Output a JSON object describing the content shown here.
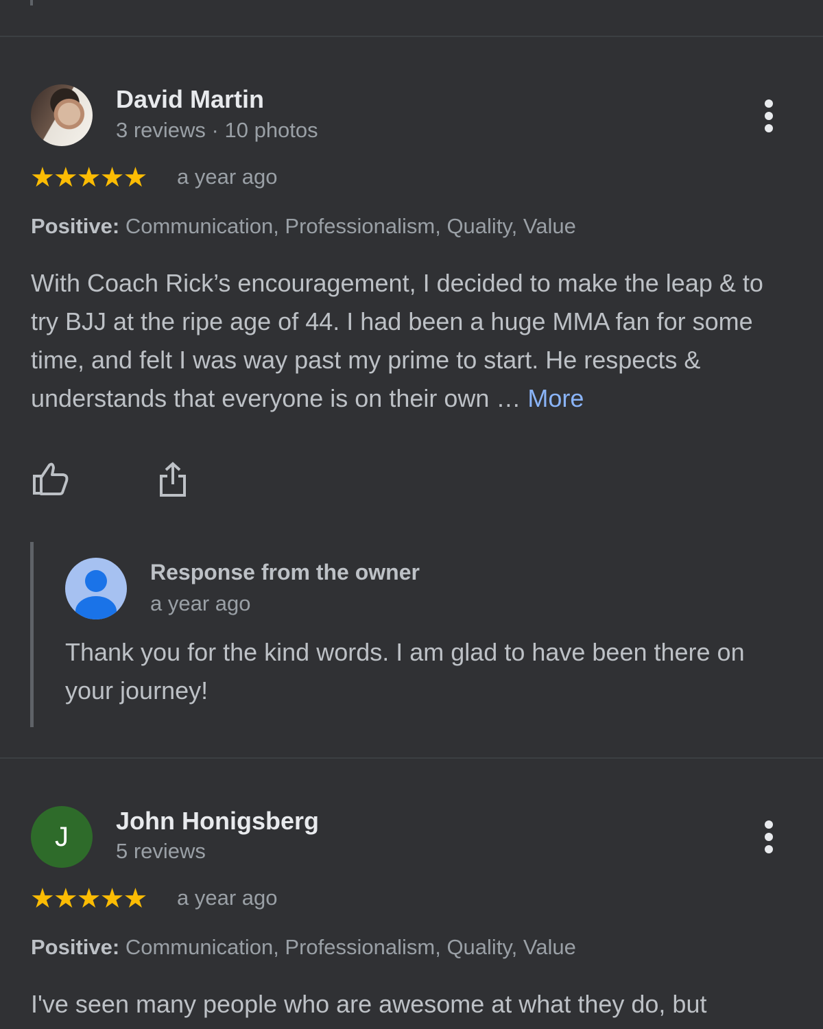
{
  "reviews": [
    {
      "name": "David Martin",
      "meta": "3 reviews · 10 photos",
      "rating": 5,
      "stars": "★★★★★",
      "time": "a year ago",
      "positive_label": "Positive:",
      "positive_values": " Communication, Professionalism, Quality, Value",
      "text": "With Coach Rick’s encouragement, I decided to make the leap & to try BJJ at the ripe age of 44. I had been a huge MMA fan for some time, and felt I was way past my prime to start. He respects & understands that everyone is on their own … ",
      "more_label": "More",
      "owner_response": {
        "title": "Response from the owner",
        "time": "a year ago",
        "text": "Thank you for the kind words. I am glad to have been there on your journey!"
      }
    },
    {
      "name": "John Honigsberg",
      "avatar_letter": "J",
      "meta": "5 reviews",
      "rating": 5,
      "stars": "★★★★★",
      "time": "a year ago",
      "positive_label": "Positive:",
      "positive_values": " Communication, Professionalism, Quality, Value",
      "text": "I've seen many people who are awesome at what they do, but"
    }
  ],
  "icons": {
    "like": "thumbs-up-icon",
    "share": "share-icon",
    "menu": "more-vert-icon"
  },
  "colors": {
    "background": "#303134",
    "star": "#fbbc04",
    "link": "#8ab4f8",
    "avatar_letter_bg": "#2e6b2a"
  }
}
